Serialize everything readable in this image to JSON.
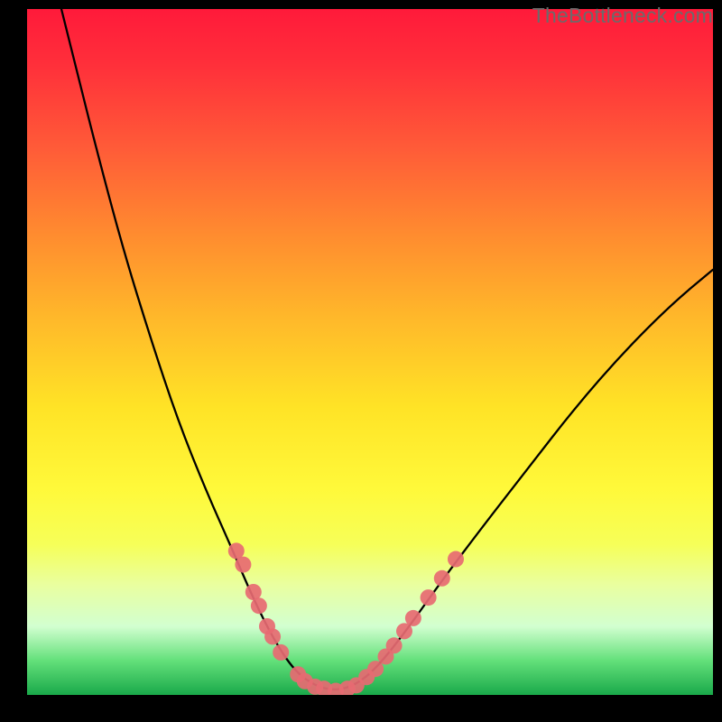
{
  "chart_data": {
    "type": "line",
    "title": "",
    "xlabel": "",
    "ylabel": "",
    "xlim": [
      0,
      100
    ],
    "ylim": [
      0,
      100
    ],
    "curve": [
      {
        "x": 5,
        "y": 100
      },
      {
        "x": 7,
        "y": 92
      },
      {
        "x": 10,
        "y": 80
      },
      {
        "x": 14,
        "y": 65
      },
      {
        "x": 18,
        "y": 52
      },
      {
        "x": 22,
        "y": 40
      },
      {
        "x": 26,
        "y": 30
      },
      {
        "x": 30,
        "y": 21
      },
      {
        "x": 33,
        "y": 14
      },
      {
        "x": 36,
        "y": 8
      },
      {
        "x": 39,
        "y": 3.5
      },
      {
        "x": 42,
        "y": 1.3
      },
      {
        "x": 45,
        "y": 0.6
      },
      {
        "x": 48,
        "y": 1.5
      },
      {
        "x": 51,
        "y": 4
      },
      {
        "x": 55,
        "y": 9
      },
      {
        "x": 60,
        "y": 16
      },
      {
        "x": 66,
        "y": 24
      },
      {
        "x": 73,
        "y": 33
      },
      {
        "x": 80,
        "y": 42
      },
      {
        "x": 87,
        "y": 50
      },
      {
        "x": 94,
        "y": 57
      },
      {
        "x": 100,
        "y": 62
      }
    ],
    "markers": [
      {
        "x": 30.5,
        "y": 21
      },
      {
        "x": 31.5,
        "y": 19
      },
      {
        "x": 33.0,
        "y": 15
      },
      {
        "x": 33.8,
        "y": 13
      },
      {
        "x": 35.0,
        "y": 10
      },
      {
        "x": 35.8,
        "y": 8.5
      },
      {
        "x": 37.0,
        "y": 6.2
      },
      {
        "x": 39.5,
        "y": 3.0
      },
      {
        "x": 40.5,
        "y": 2.0
      },
      {
        "x": 42.0,
        "y": 1.2
      },
      {
        "x": 43.3,
        "y": 0.9
      },
      {
        "x": 45.0,
        "y": 0.6
      },
      {
        "x": 46.7,
        "y": 0.9
      },
      {
        "x": 48.0,
        "y": 1.4
      },
      {
        "x": 49.5,
        "y": 2.6
      },
      {
        "x": 50.8,
        "y": 3.8
      },
      {
        "x": 52.3,
        "y": 5.6
      },
      {
        "x": 53.5,
        "y": 7.2
      },
      {
        "x": 55.0,
        "y": 9.3
      },
      {
        "x": 56.3,
        "y": 11.2
      },
      {
        "x": 58.5,
        "y": 14.2
      },
      {
        "x": 60.5,
        "y": 17
      },
      {
        "x": 62.5,
        "y": 19.8
      }
    ],
    "marker_color": "#e76a72",
    "marker_radius": 9,
    "curve_color": "#000000",
    "curve_width": 2.3
  },
  "watermark": "TheBottleneck.com"
}
